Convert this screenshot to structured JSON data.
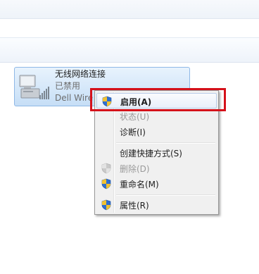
{
  "adapter": {
    "name": "无线网络连接",
    "status": "已禁用",
    "device": "Dell Wire",
    "icon": "wireless-adapter-icon"
  },
  "context_menu": {
    "items": [
      {
        "label": "启用(A)",
        "icon": "uac-shield-icon",
        "enabled": true,
        "default": true,
        "highlighted": true
      },
      {
        "label": "状态(U)",
        "icon": null,
        "enabled": false
      },
      {
        "label": "诊断(I)",
        "icon": null,
        "enabled": true
      },
      {
        "label": "创建快捷方式(S)",
        "icon": null,
        "enabled": true
      },
      {
        "label": "删除(D)",
        "icon": "uac-shield-icon",
        "enabled": false
      },
      {
        "label": "重命名(M)",
        "icon": "uac-shield-icon",
        "enabled": true
      },
      {
        "label": "属性(R)",
        "icon": "uac-shield-icon",
        "enabled": true
      }
    ]
  },
  "colors": {
    "highlight_box": "#d5111a",
    "tile_border": "#8fb8e6",
    "disabled_text": "#9a9a9a"
  }
}
